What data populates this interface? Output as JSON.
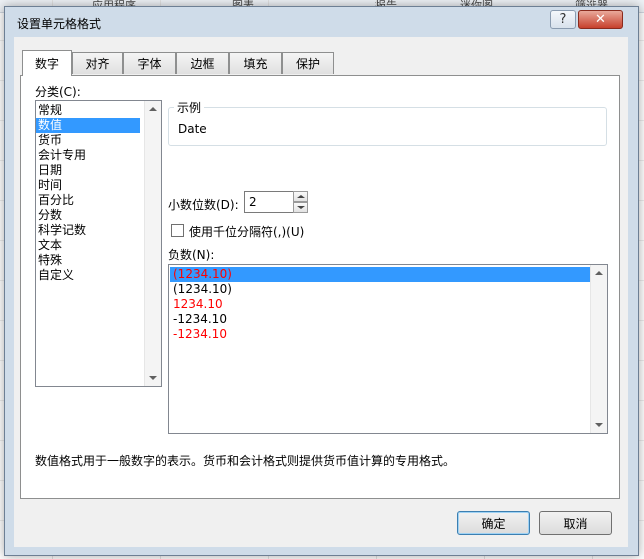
{
  "sheet": {
    "headers": [
      "应用程序",
      "图表",
      "报告",
      "迷你图",
      "筛选器"
    ]
  },
  "dialog": {
    "title": "设置单元格格式",
    "help_label": "?",
    "close_label": "✕",
    "tabs": [
      "数字",
      "对齐",
      "字体",
      "边框",
      "填充",
      "保护"
    ],
    "active_tab": "数字",
    "category_label": "分类(C):",
    "categories": [
      "常规",
      "数值",
      "货币",
      "会计专用",
      "日期",
      "时间",
      "百分比",
      "分数",
      "科学记数",
      "文本",
      "特殊",
      "自定义"
    ],
    "selected_category": "数值",
    "sample": {
      "title": "示例",
      "value": "Date"
    },
    "decimal": {
      "label": "小数位数(D):",
      "value": "2"
    },
    "thousands": {
      "label": "使用千位分隔符(,)(U)",
      "checked": false
    },
    "negative_label": "负数(N):",
    "negative_options": [
      {
        "text": "(1234.10)",
        "color": "#ff0000",
        "selected": true
      },
      {
        "text": "(1234.10)",
        "color": "#000000",
        "selected": false
      },
      {
        "text": "1234.10",
        "color": "#ff0000",
        "selected": false
      },
      {
        "text": "-1234.10",
        "color": "#000000",
        "selected": false
      },
      {
        "text": "-1234.10",
        "color": "#ff0000",
        "selected": false
      }
    ],
    "description": "数值格式用于一般数字的表示。货币和会计格式则提供货币值计算的专用格式。",
    "ok_label": "确定",
    "cancel_label": "取消"
  }
}
